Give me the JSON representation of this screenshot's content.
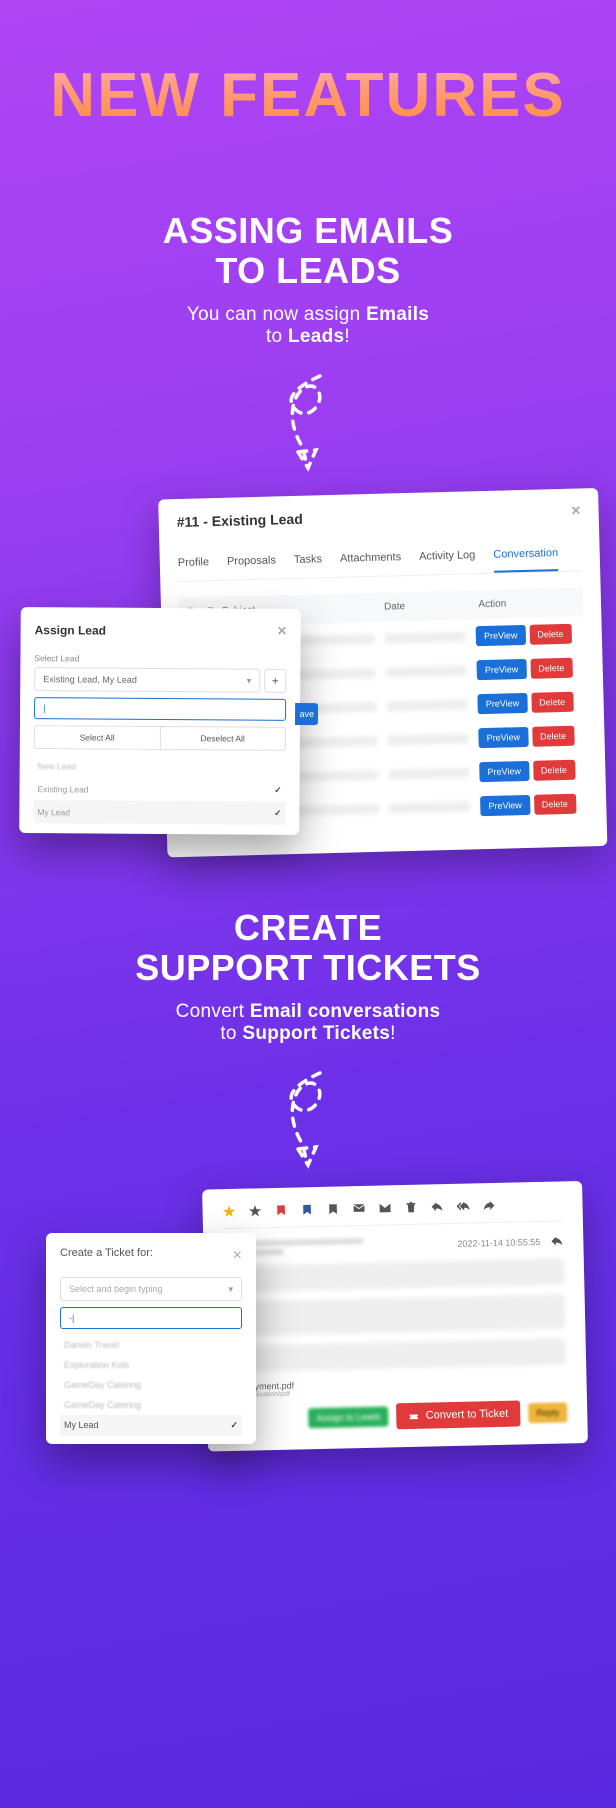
{
  "banner": {
    "title": "NEW FEATURES"
  },
  "section1": {
    "title_line1": "ASSING EMAILS",
    "title_line2": "TO LEADS",
    "sub_pre": "You can now assign ",
    "sub_bold1": "Emails",
    "sub_mid": "to ",
    "sub_bold2": "Leads",
    "sub_suffix": "!"
  },
  "lead_panel": {
    "title": "#11 - Existing Lead",
    "tabs": [
      "Profile",
      "Proposals",
      "Tasks",
      "Attachments",
      "Activity Log",
      "Conversation"
    ],
    "active_tab": 5,
    "columns": {
      "subject": "Email's Subject",
      "date": "Date",
      "action": "Action"
    },
    "row_count": 6,
    "preview_label": "PreView",
    "delete_label": "Delete"
  },
  "assign_modal": {
    "title": "Assign Lead",
    "select_label": "Select Lead",
    "select_value": "Existing Lead, My Lead",
    "search_value": "|",
    "select_all": "Select All",
    "deselect_all": "Deselect All",
    "save_label": "ave",
    "leads": [
      {
        "name": "New Lead",
        "checked": false
      },
      {
        "name": "Existing Lead",
        "checked": true
      },
      {
        "name": "My Lead",
        "checked": true
      }
    ]
  },
  "section2": {
    "title_line1": "CREATE",
    "title_line2": "SUPPORT TICKETS",
    "sub_pre": "Convert ",
    "sub_bold1": "Email conversations",
    "sub_mid": "to ",
    "sub_bold2": "Support Tickets",
    "sub_suffix": "!"
  },
  "mail_panel": {
    "timestamp": "2022-11-14 10:55:55",
    "attachment": {
      "name": "payment.pdf",
      "type": "application/pdf"
    },
    "assign_leads": "Assign to Leads",
    "convert": "Convert to Ticket",
    "reply": "Reply"
  },
  "ticket_modal": {
    "title": "Create a Ticket for:",
    "select_placeholder": "Select and begin typing",
    "search_value": "-|",
    "options": [
      "Darwin Travel",
      "Exploration Kids",
      "GameDay Catering",
      "GameDay Catering",
      "My Lead"
    ]
  }
}
